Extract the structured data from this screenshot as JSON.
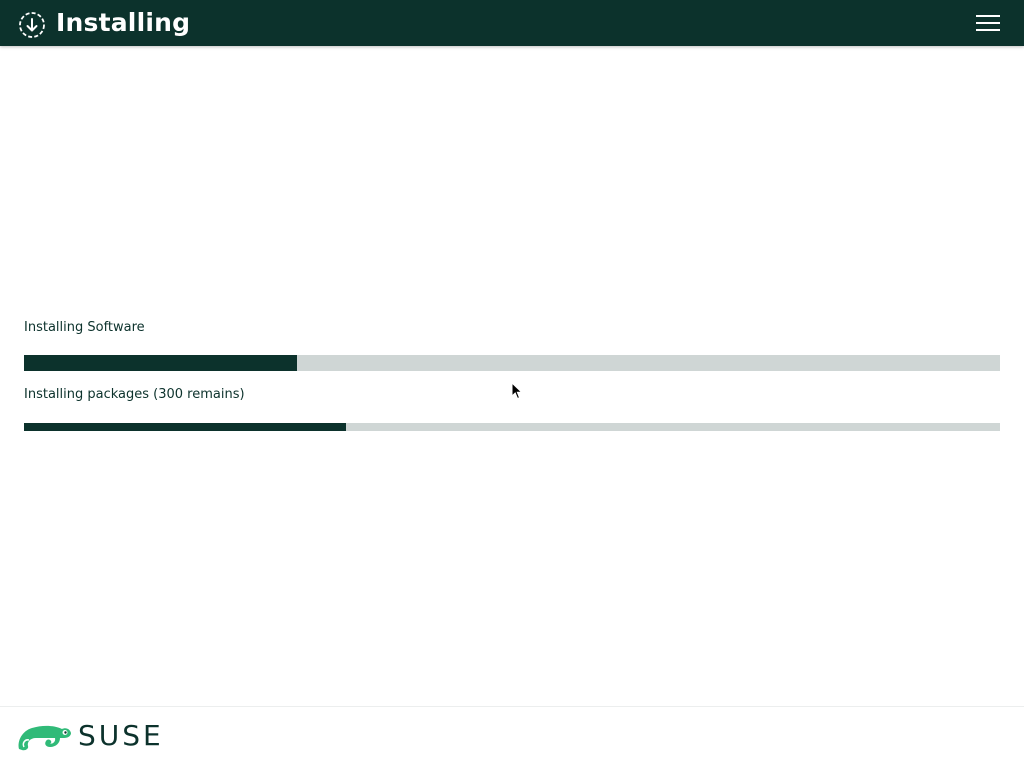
{
  "header": {
    "title": "Installing",
    "icon": "download-circle-icon",
    "menu_icon": "hamburger-menu-icon"
  },
  "progress": {
    "main_label": "Installing Software",
    "main_fraction": 0.28,
    "sub_label": "Installing packages (300 remains)",
    "sub_fraction": 0.33
  },
  "footer": {
    "brand_name": "SUSE",
    "brand_icon": "suse-chameleon-logo"
  },
  "colors": {
    "header_bg": "#0c322c",
    "bar_fill": "#0c322c",
    "bar_track": "#cfd6d5",
    "brand_green": "#30ba78"
  }
}
